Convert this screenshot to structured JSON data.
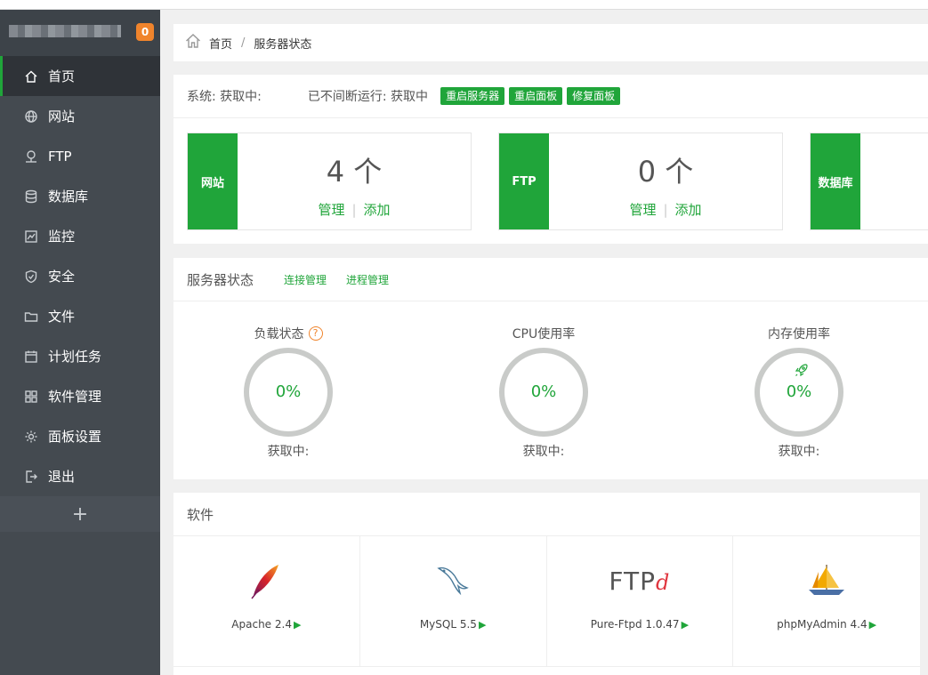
{
  "notice_count": "0",
  "sidebar": {
    "items": [
      {
        "label": "首页",
        "icon": "home-icon",
        "active": true
      },
      {
        "label": "网站",
        "icon": "globe-icon"
      },
      {
        "label": "FTP",
        "icon": "ftp-icon"
      },
      {
        "label": "数据库",
        "icon": "database-icon"
      },
      {
        "label": "监控",
        "icon": "monitor-icon"
      },
      {
        "label": "安全",
        "icon": "shield-icon"
      },
      {
        "label": "文件",
        "icon": "folder-icon"
      },
      {
        "label": "计划任务",
        "icon": "calendar-icon"
      },
      {
        "label": "软件管理",
        "icon": "grid-icon"
      },
      {
        "label": "面板设置",
        "icon": "gear-icon"
      },
      {
        "label": "退出",
        "icon": "logout-icon"
      }
    ],
    "add_label": "+"
  },
  "breadcrumb": {
    "home": "首页",
    "sep": "/",
    "current": "服务器状态"
  },
  "system": {
    "label": "系统: 获取中:",
    "uptime": "已不间断运行: 获取中",
    "buttons": [
      "重启服务器",
      "重启面板",
      "修复面板"
    ]
  },
  "stats": [
    {
      "tag": "网站",
      "count": "4 个",
      "manage": "管理",
      "add": "添加"
    },
    {
      "tag": "FTP",
      "count": "0 个",
      "manage": "管理",
      "add": "添加"
    },
    {
      "tag": "数据库"
    }
  ],
  "server_status": {
    "title": "服务器状态",
    "links": [
      "连接管理",
      "进程管理"
    ],
    "gauges": [
      {
        "title": "负载状态",
        "value": "0%",
        "foot": "获取中:",
        "help": "?"
      },
      {
        "title": "CPU使用率",
        "value": "0%",
        "foot": "获取中:"
      },
      {
        "title": "内存使用率",
        "value": "0%",
        "foot": "获取中:"
      }
    ]
  },
  "software": {
    "title": "软件",
    "items": [
      {
        "name": "Apache 2.4",
        "icon": "apache-feather-icon"
      },
      {
        "name": "MySQL 5.5",
        "icon": "mysql-dolphin-icon"
      },
      {
        "name": "Pure-Ftpd 1.0.47",
        "icon": "ftpd-logo-icon"
      },
      {
        "name": "phpMyAdmin 4.4",
        "icon": "phpmyadmin-sailboat-icon"
      }
    ],
    "arrow": "▶",
    "ftp_logo": {
      "text": "FTP",
      "suffix": "d"
    }
  },
  "colors": {
    "accent": "#20a53a",
    "sidebar": "#444a50",
    "badge": "#f0842c"
  }
}
